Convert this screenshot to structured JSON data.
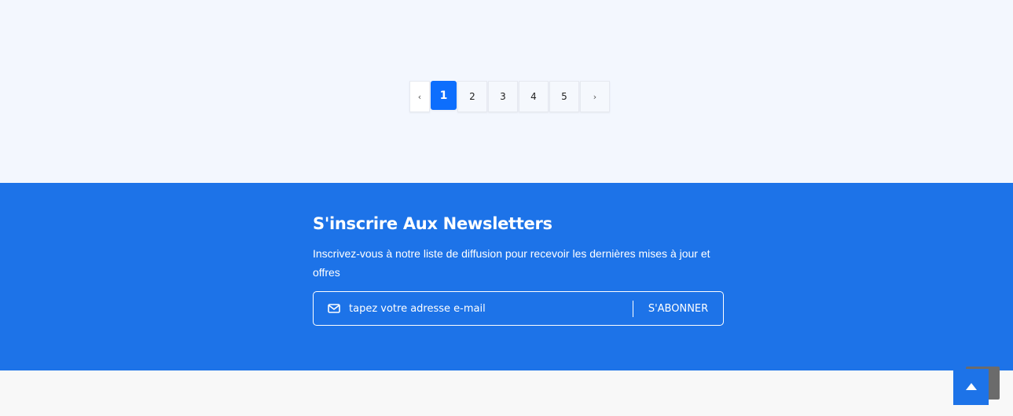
{
  "pagination": {
    "prev_label": "‹",
    "pages": [
      "1",
      "2",
      "3",
      "4",
      "5"
    ],
    "active_page": "1",
    "next_label": "›"
  },
  "newsletter": {
    "title": "S'inscrire Aux Newsletters",
    "description": "Inscrivez-vous à notre liste de diffusion pour recevoir les dernières mises à jour et offres",
    "email_placeholder": "tapez votre adresse e-mail",
    "subscribe_label": "S'ABONNER",
    "icon": "envelope-icon"
  },
  "scroll_top": {
    "icon": "caret-up-icon"
  },
  "colors": {
    "accent": "#1d73e8",
    "active_page": "#0d6efd",
    "page_bg": "#f3f7fe",
    "footer_bg": "#f8f8f8"
  }
}
